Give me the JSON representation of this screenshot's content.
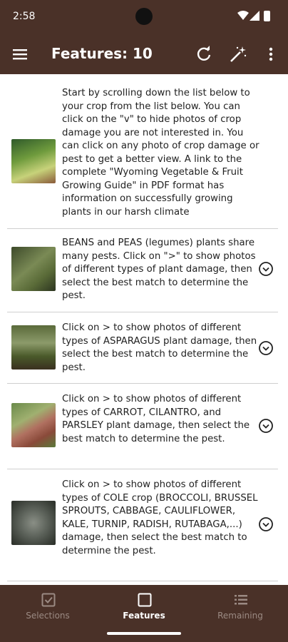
{
  "status_bar": {
    "time": "2:58"
  },
  "app_bar": {
    "title": "Features: 10"
  },
  "items": [
    {
      "text": "Start by scrolling down the list below to your crop from the list below. You can click on the \"v\" to hide photos of crop damage you are not interested in. You can click on any photo of crop damage or pest to get a better view. A link to the complete \"Wyoming Vegetable & Fruit Growing Guide\" in PDF format has information on successfully growing plants in our harsh climate",
      "has_chevron": false
    },
    {
      "text": "BEANS and PEAS (legumes) plants share many pests. Click on \">\" to show photos of different types of plant damage, then select the best match to determine the pest.",
      "has_chevron": true
    },
    {
      "text": "Click on > to show photos of different types of ASPARAGUS plant damage, then select the best match to determine the pest.",
      "has_chevron": true
    },
    {
      "text": "Click on > to show photos of different types of CARROT, CILANTRO, and PARSLEY plant damage, then select the best match to determine the pest.",
      "has_chevron": true
    },
    {
      "text": "Click on > to show photos of different types of COLE crop (BROCCOLI, BRUSSEL SPROUTS, CABBAGE, CAULIFLOWER, KALE, TURNIP, RADISH, RUTABAGA,...) damage, then select the best match to determine the pest.",
      "has_chevron": true
    }
  ],
  "bottom_nav": {
    "tabs": [
      {
        "label": "Selections",
        "icon": "checkbox-icon",
        "active": false
      },
      {
        "label": "Features",
        "icon": "square-icon",
        "active": true
      },
      {
        "label": "Remaining",
        "icon": "list-icon",
        "active": false
      }
    ]
  },
  "colors": {
    "bar": "#4a3128",
    "inactive_tab": "#9b8a83",
    "active_tab": "#ffffff"
  }
}
